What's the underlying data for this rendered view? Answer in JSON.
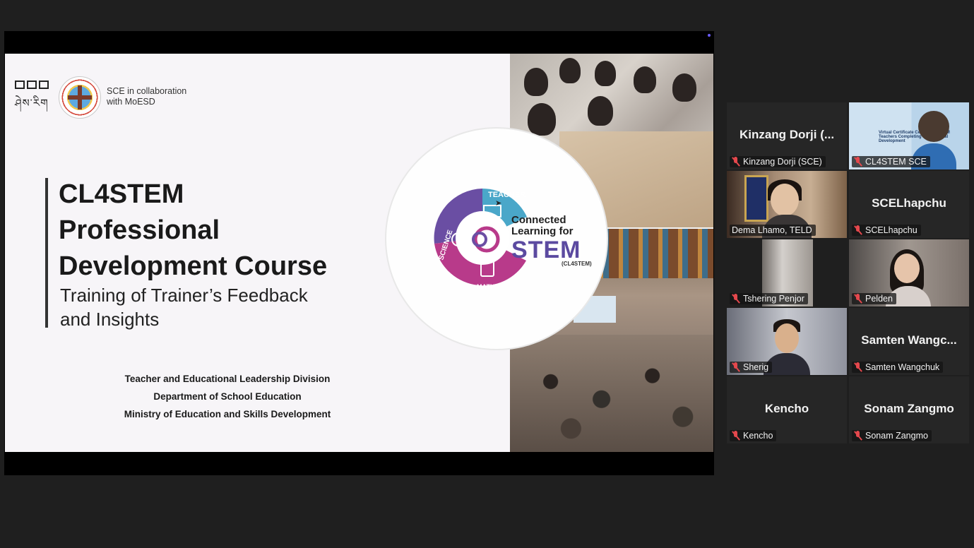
{
  "slide": {
    "collab_line1": "SCE in collaboration",
    "collab_line2": "with MoESD",
    "title_line1": "CL4STEM",
    "title_line2": "Professional",
    "title_line3": "Development Course",
    "subtitle_line1": "Training of Trainer’s Feedback",
    "subtitle_line2": "and Insights",
    "org_line1": "Teacher and Educational Leadership Division",
    "org_line2": "Department of School Education",
    "org_line3": "Ministry of Education and Skills Development",
    "logo": {
      "segment_teacher": "TEACHER",
      "segment_science": "SCIENCE",
      "segment_math": "MATH",
      "text_line1": "Connected",
      "text_line2": "Learning for",
      "text_big": "STEM",
      "text_small": "(CL4STEM)",
      "colors": {
        "teacher": "#4aa7c9",
        "science": "#6a4ea3",
        "math": "#b83a8a"
      }
    }
  },
  "gallery": {
    "accent_active": "#36c46b",
    "participants": [
      {
        "big_name": "Kinzang Dorji (...",
        "label": "Kinzang Dorji (SCE)",
        "muted": true,
        "video": false
      },
      {
        "big_name": "",
        "label": "CL4STEM SCE",
        "muted": true,
        "video": true,
        "slide_text": "Virtual Certificate Ceremony: STEM Teachers Completing Professional Development"
      },
      {
        "big_name": "",
        "label": "Dema Lhamo, TELD",
        "muted": false,
        "video": true,
        "active": true
      },
      {
        "big_name": "SCELhapchu",
        "label": "SCELhapchu",
        "muted": true,
        "video": false
      },
      {
        "big_name": "",
        "label": "Tshering Penjor",
        "muted": true,
        "video": true
      },
      {
        "big_name": "",
        "label": "Pelden",
        "muted": true,
        "video": true
      },
      {
        "big_name": "",
        "label": "Sherig",
        "muted": true,
        "video": true
      },
      {
        "big_name": "Samten  Wangc...",
        "label": "Samten Wangchuk",
        "muted": true,
        "video": false
      },
      {
        "big_name": "Kencho",
        "label": "Kencho",
        "muted": true,
        "video": false
      },
      {
        "big_name": "Sonam Zangmo",
        "label": "Sonam Zangmo",
        "muted": true,
        "video": false
      }
    ]
  }
}
